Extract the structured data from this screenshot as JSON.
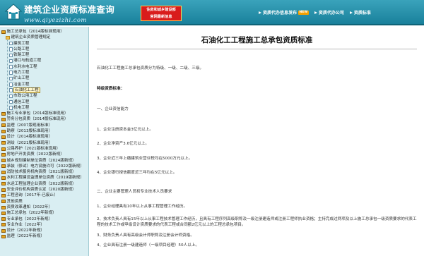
{
  "header": {
    "site_title": "建筑企业资质标准查询",
    "site_domain": "www.qiyezizhi.com",
    "banner_line1": "住房和城乡建设部",
    "banner_line2": "官网最新信息",
    "nav": [
      {
        "label": "资质代办信息发布",
        "badge": "NEW"
      },
      {
        "label": "资质代办公司",
        "badge": ""
      },
      {
        "label": "资质标准",
        "badge": ""
      }
    ]
  },
  "sidebar": {
    "items": [
      {
        "label": "施工总承包（2014版标准现用）",
        "level": 1,
        "icon": "book-icon"
      },
      {
        "label": "建筑企业资质管理规定",
        "level": 2,
        "icon": "folder-icon"
      },
      {
        "label": "建筑工程",
        "level": 3,
        "icon": "page-icon"
      },
      {
        "label": "公路工程",
        "level": 3,
        "icon": "page-icon"
      },
      {
        "label": "铁路工程",
        "level": 3,
        "icon": "page-icon"
      },
      {
        "label": "港口与航道工程",
        "level": 3,
        "icon": "page-icon"
      },
      {
        "label": "水利水电工程",
        "level": 3,
        "icon": "page-icon"
      },
      {
        "label": "电力工程",
        "level": 3,
        "icon": "page-icon"
      },
      {
        "label": "矿山工程",
        "level": 3,
        "icon": "page-icon"
      },
      {
        "label": "冶金工程",
        "level": 3,
        "icon": "page-icon"
      },
      {
        "label": "石油化工工程",
        "level": 3,
        "icon": "page-icon",
        "selected": true
      },
      {
        "label": "市政公用工程",
        "level": 3,
        "icon": "page-icon"
      },
      {
        "label": "通信工程",
        "level": 3,
        "icon": "page-icon"
      },
      {
        "label": "机电工程",
        "level": 3,
        "icon": "page-icon"
      },
      {
        "label": "施工专业承包（2014版标准现用）",
        "level": 1,
        "icon": "book-icon"
      },
      {
        "label": "劳务分包资质（2014版标准现用）",
        "level": 1,
        "icon": "book-icon"
      },
      {
        "label": "监理（2007版现用标准）",
        "level": 1,
        "icon": "book-icon"
      },
      {
        "label": "勘察（2013版标准现用）",
        "level": 1,
        "icon": "book-icon"
      },
      {
        "label": "设计（2014版标准现用）",
        "level": 1,
        "icon": "book-icon"
      },
      {
        "label": "测绘（2021版标准现用）",
        "level": 1,
        "icon": "book-icon"
      },
      {
        "label": "公路养护（2021版标准现用）",
        "level": 1,
        "icon": "book-icon"
      },
      {
        "label": "房地产开发资质（2022版新规）",
        "level": 1,
        "icon": "book-icon"
      },
      {
        "label": "城乡规划编制单位资质（2024版新规）",
        "level": 1,
        "icon": "book-icon"
      },
      {
        "label": "承装（修试）电力设施许可（2022版新规）",
        "level": 1,
        "icon": "book-icon"
      },
      {
        "label": "消防技术服务机构资质（2021版新规）",
        "level": 1,
        "icon": "book-icon"
      },
      {
        "label": "水利工程建设监理单位资质（2019版新规）",
        "level": 1,
        "icon": "book-icon"
      },
      {
        "label": "水运工程监理企业资质（2022版新规）",
        "level": 1,
        "icon": "book-icon"
      },
      {
        "label": "安全评价机构资质认定（2020版新规）",
        "level": 1,
        "icon": "book-icon"
      },
      {
        "label": "工程咨询（2017年-已废止）",
        "level": 1,
        "icon": "book-icon"
      },
      {
        "label": "其他资质",
        "level": 1,
        "icon": "book-icon"
      },
      {
        "label": "资质改革通知（2022年）",
        "level": 1,
        "icon": "book-icon"
      },
      {
        "label": "施工总承包（2022年新规）",
        "level": 1,
        "icon": "book-icon"
      },
      {
        "label": "专业承包（2022年新规）",
        "level": 1,
        "icon": "book-icon"
      },
      {
        "label": "专业作业（2022年）",
        "level": 1,
        "icon": "book-icon"
      },
      {
        "label": "设计（2022年新规）",
        "level": 1,
        "icon": "book-icon"
      },
      {
        "label": "监理（2022年新规）",
        "level": 1,
        "icon": "book-icon"
      }
    ]
  },
  "main": {
    "title": "石油化工工程施工总承包资质标准",
    "intro": "石油化工工程施工总承包资质分为特级、一级、二级、三级。",
    "section_heading": "特级资质标准：",
    "sub1": "一、企业资信能力",
    "sub1_items": [
      "1、企业注册资本金3亿元以上。",
      "2、企业净资产3.6亿元以上。",
      "3、企业近三年上缴建筑业营业税均在5000万元以上。",
      "4、企业银行授信额度近三年均在5亿元以上。"
    ],
    "sub2": "二、企业主要管理人员和专业技术人员要求",
    "sub2_items": [
      "1、企业经理具有10年以上从事工程管理工作经历。",
      "2、技术负责人具有15年以上从事工程技术管理工作经历，且具有工程序列高级职称及一级注册建造师或注册工程师执业资格；主持完成过两项及以上施工总承包一级资质要求的代表工程的技术工作或甲级设计资质要求的代表工程或合同额2亿元以上的工程总承包项目。",
      "3、财务负责人具有高级会计师职称及注册会计师资格。",
      "4、企业具有注册一级建造师（一级项目经理）50人以上。"
    ]
  },
  "colors": {
    "header_bg": "#1f8aa4",
    "sidebar_bg": "#d9eef2",
    "banner_bg": "#d91c1c"
  }
}
